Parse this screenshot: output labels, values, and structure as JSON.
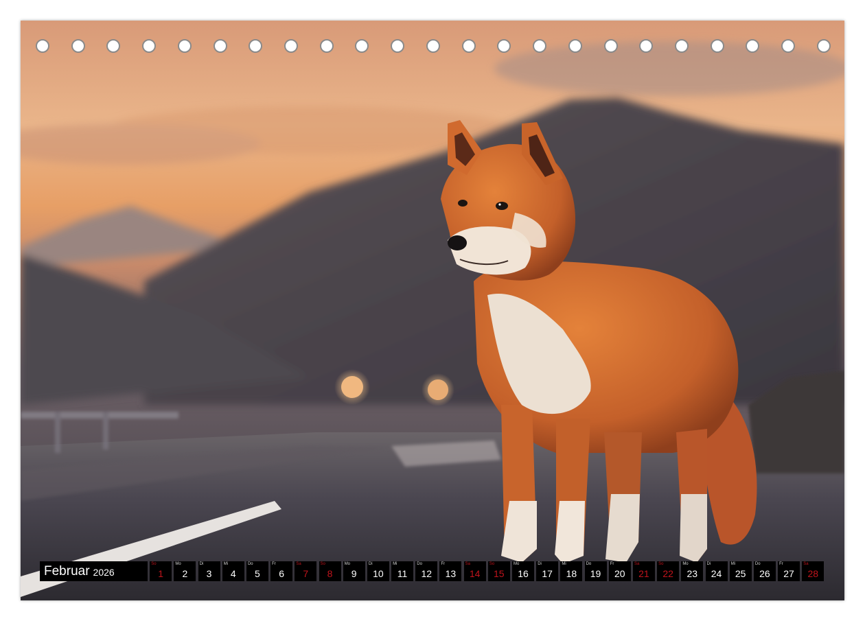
{
  "calendar": {
    "month": "Februar",
    "year": "2026",
    "days": [
      {
        "dow": "So",
        "num": "1",
        "red": true
      },
      {
        "dow": "Mo",
        "num": "2",
        "red": false
      },
      {
        "dow": "Di",
        "num": "3",
        "red": false
      },
      {
        "dow": "Mi",
        "num": "4",
        "red": false
      },
      {
        "dow": "Do",
        "num": "5",
        "red": false
      },
      {
        "dow": "Fr",
        "num": "6",
        "red": false
      },
      {
        "dow": "Sa",
        "num": "7",
        "red": true
      },
      {
        "dow": "So",
        "num": "8",
        "red": true
      },
      {
        "dow": "Mo",
        "num": "9",
        "red": false
      },
      {
        "dow": "Di",
        "num": "10",
        "red": false
      },
      {
        "dow": "Mi",
        "num": "11",
        "red": false
      },
      {
        "dow": "Do",
        "num": "12",
        "red": false
      },
      {
        "dow": "Fr",
        "num": "13",
        "red": false
      },
      {
        "dow": "Sa",
        "num": "14",
        "red": true
      },
      {
        "dow": "So",
        "num": "15",
        "red": true
      },
      {
        "dow": "Mo",
        "num": "16",
        "red": false
      },
      {
        "dow": "Di",
        "num": "17",
        "red": false
      },
      {
        "dow": "Mi",
        "num": "18",
        "red": false
      },
      {
        "dow": "Do",
        "num": "19",
        "red": false
      },
      {
        "dow": "Fr",
        "num": "20",
        "red": false
      },
      {
        "dow": "Sa",
        "num": "21",
        "red": true
      },
      {
        "dow": "So",
        "num": "22",
        "red": true
      },
      {
        "dow": "Mo",
        "num": "23",
        "red": false
      },
      {
        "dow": "Di",
        "num": "24",
        "red": false
      },
      {
        "dow": "Mi",
        "num": "25",
        "red": false
      },
      {
        "dow": "Do",
        "num": "26",
        "red": false
      },
      {
        "dow": "Fr",
        "num": "27",
        "red": false
      },
      {
        "dow": "Sa",
        "num": "28",
        "red": true
      }
    ]
  },
  "binding_holes": 23,
  "colors": {
    "weekend_red": "#c0141c",
    "bar_black": "#000000",
    "sky_orange": "#e0a070",
    "dog_orange": "#c8672a"
  }
}
